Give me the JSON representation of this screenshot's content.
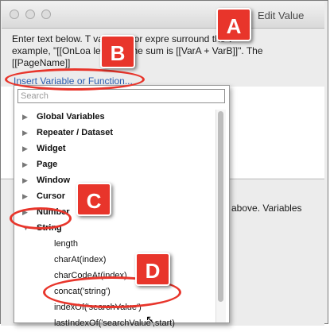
{
  "window": {
    "title": "Edit Value"
  },
  "description": {
    "line1": "Enter text below. T        variables or expre         surround the v",
    "line2": "example, \"[[OnLoa          le]]\" or \"The sum is [[VarA + VarB]]\". The",
    "line3": "[[PageName]]"
  },
  "insert_link": "Insert Variable or Function...",
  "search": {
    "placeholder": "Search"
  },
  "tree": [
    {
      "label": "Global Variables",
      "kind": "cat",
      "arrow": "▶"
    },
    {
      "label": "Repeater / Dataset",
      "kind": "cat",
      "arrow": "▶"
    },
    {
      "label": "Widget",
      "kind": "cat",
      "arrow": "▶"
    },
    {
      "label": "Page",
      "kind": "cat",
      "arrow": "▶"
    },
    {
      "label": "Window",
      "kind": "cat",
      "arrow": "▶"
    },
    {
      "label": "Cursor",
      "kind": "cat",
      "arrow": "▶"
    },
    {
      "label": "Number",
      "kind": "cat",
      "arrow": "▶"
    },
    {
      "label": "String",
      "kind": "cat",
      "arrow": "▼"
    },
    {
      "label": "length",
      "kind": "child"
    },
    {
      "label": "charAt(index)",
      "kind": "child"
    },
    {
      "label": "charCodeAt(index)",
      "kind": "child"
    },
    {
      "label": "concat('string')",
      "kind": "child"
    },
    {
      "label": "indexOf('searchValue')",
      "kind": "child"
    },
    {
      "label": "lastIndexOf('searchValue',start)",
      "kind": "child"
    }
  ],
  "lower_text": "above. Variables",
  "badges": {
    "a": "A",
    "b": "B",
    "c": "C",
    "d": "D"
  },
  "colors": {
    "accent": "#e8352b",
    "link": "#2a5db0"
  }
}
